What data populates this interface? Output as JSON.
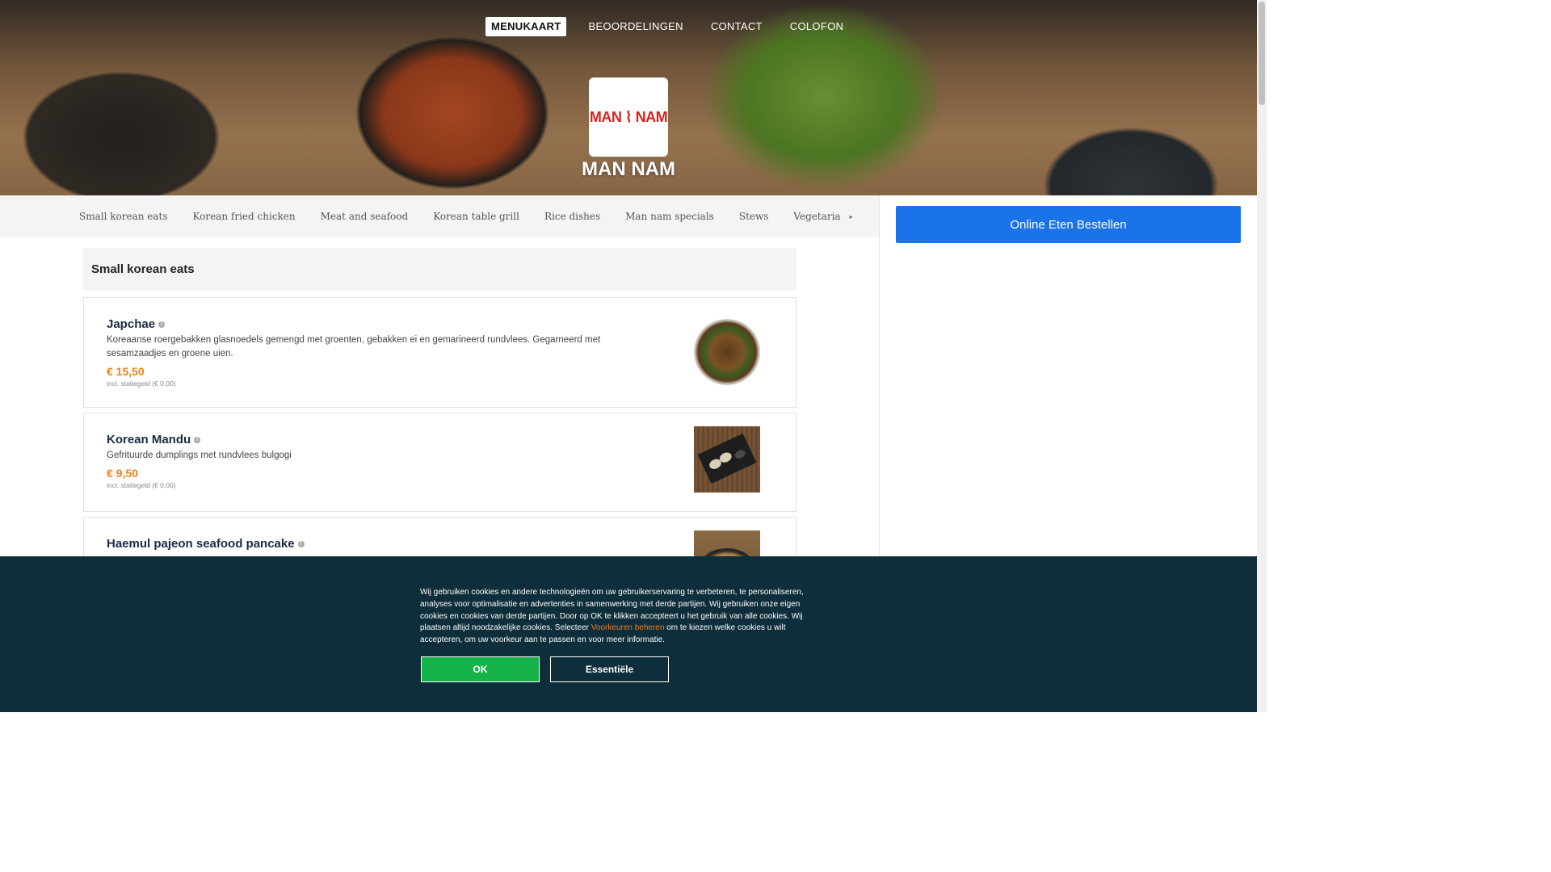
{
  "nav": {
    "items": [
      "MENUKAART",
      "BEOORDELINGEN",
      "CONTACT",
      "COLOFON"
    ],
    "active": "MENUKAART"
  },
  "restaurant": {
    "logo_text": "MAN ⌇ NAM",
    "name": "MAN NAM"
  },
  "categories": [
    "Small korean eats",
    "Korean fried chicken",
    "Meat and seafood",
    "Korean table grill",
    "Rice dishes",
    "Man nam specials",
    "Stews",
    "Vegetaria"
  ],
  "categories_more_icon": "chevron-icon",
  "order_button": "Online Eten Bestellen",
  "section": {
    "title": "Small korean eats",
    "items": [
      {
        "name": "Japchae",
        "description": "Koreaanse roergebakken glasnoedels gemengd met groenten, gebakken ei en gemarineerd rundvlees. Gegarneerd met sesamzaadjes en groene uien.",
        "price": "€ 15,50",
        "deposit": "incl. statiegeld (€ 0,00)"
      },
      {
        "name": "Korean Mandu",
        "description": "Gefrituurde dumplings met rundvlees bulgogi",
        "price": "€ 9,50",
        "deposit": "incl. statiegeld (€ 0,00)"
      },
      {
        "name": "Haemul pajeon seafood pancake",
        "description": "",
        "price": "",
        "deposit": ""
      }
    ]
  },
  "cookie": {
    "text_before": "Wij gebruiken cookies en andere technologieën om uw gebruikerservaring te verbeteren, te personaliseren, analyses voor optimalisatie en advertenties in samenwerking met derde partijen. Wij gebruiken onze eigen cookies en cookies van derde partijen. Door op OK te klikken accepteert u het gebruik van alle cookies. Wij plaatsen altijd noodzakelijke cookies. Selecteer ",
    "link": "Voorkeuren beheren",
    "text_after": " om te kiezen welke cookies u wilt accepteren, om uw voorkeur aan te passen en voor meer informatie.",
    "ok": "OK",
    "essential": "Essentiële"
  }
}
